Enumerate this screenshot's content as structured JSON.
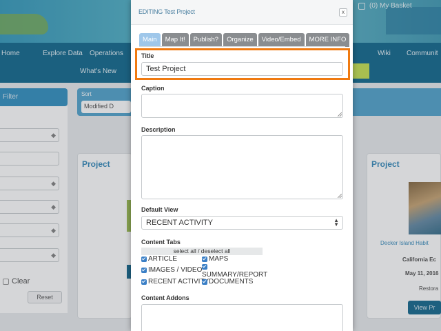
{
  "background": {
    "top_right_text": "(0) My Basket",
    "nav": {
      "items": [
        "Home",
        "Explore Data",
        "Operations",
        "Wiki",
        "Communit"
      ],
      "whats_new": "What's New"
    },
    "left_panel": {
      "head": "Filter",
      "clear_label": "Clear",
      "reset_label": "Reset"
    },
    "sort": {
      "label": "Sort",
      "selected": "Modified D"
    },
    "cards": [
      {
        "title": "Project"
      },
      {
        "title": "Project"
      }
    ],
    "right_card_lines": [
      "Decker Island Habit",
      "California Ec",
      "May 11, 2016",
      "Restora"
    ],
    "view_button": "View Pr"
  },
  "modal": {
    "title": "EDITING Test Project",
    "close_symbol": "x",
    "tabs": [
      "Main",
      "Map It!",
      "Publish?",
      "Organize",
      "Video/Embed",
      "MORE INFO"
    ],
    "active_tab": "Main",
    "fields": {
      "title_label": "Title",
      "title_value": "Test Project",
      "caption_label": "Caption",
      "caption_value": "",
      "description_label": "Description",
      "description_value": "",
      "default_view_label": "Default View",
      "default_view_value": "RECENT ACTIVITY",
      "content_tabs_label": "Content Tabs",
      "select_all_label": "select all / deselect all",
      "content_addons_label": "Content Addons"
    },
    "content_tabs": [
      {
        "label": "ARTICLE",
        "checked": true
      },
      {
        "label": "MAPS",
        "checked": true
      },
      {
        "label": "IMAGES / VIDEO",
        "checked": true
      },
      {
        "label": "SUMMARY/REPORT",
        "checked": true
      },
      {
        "label": "RECENT ACTIVITY",
        "checked": true
      },
      {
        "label": "DOCUMENTS",
        "checked": true
      }
    ],
    "highlight_color": "#f07a10",
    "active_tab_color": "#9fc7ea"
  }
}
